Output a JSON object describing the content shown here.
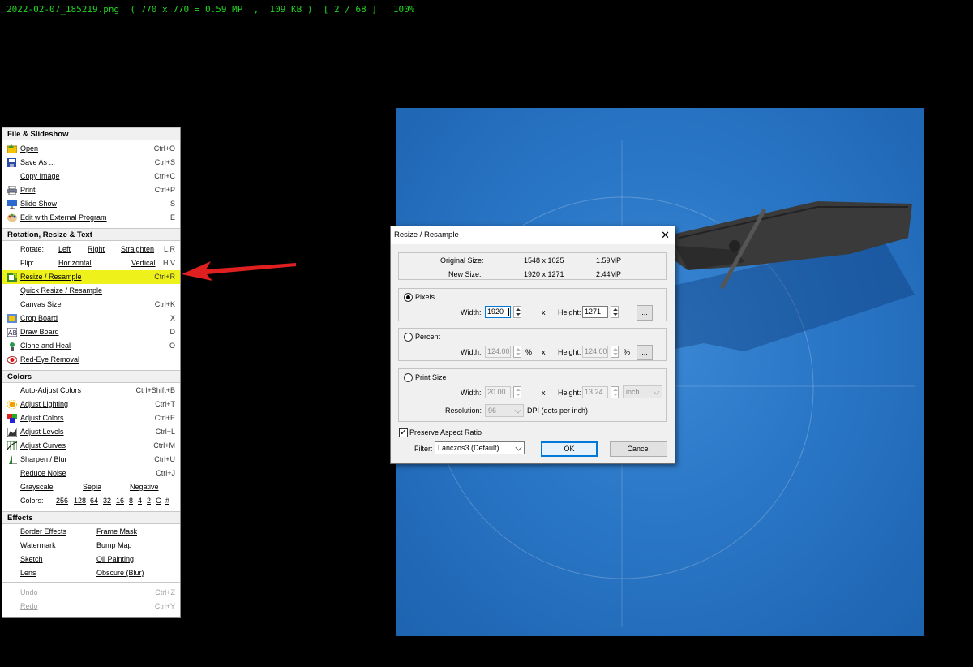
{
  "status_bar": "2022-02-07_185219.png  ( 770 x 770 = 0.59 MP  ,  109 KB )  [ 2 / 68 ]   100%",
  "colors": {
    "highlight": "#eef21a",
    "status_text": "#21d621",
    "accent": "#0078d7"
  },
  "menu": {
    "sections": {
      "file": "File & Slideshow",
      "rotation": "Rotation, Resize & Text",
      "colors": "Colors",
      "effects": "Effects"
    },
    "file_items": [
      {
        "label": "Open",
        "shortcut": "Ctrl+O",
        "icon": "folder-icon"
      },
      {
        "label": "Save As ...",
        "shortcut": "Ctrl+S",
        "icon": "floppy-icon"
      },
      {
        "label": "Copy Image",
        "shortcut": "Ctrl+C",
        "icon": ""
      },
      {
        "label": "Print",
        "shortcut": "Ctrl+P",
        "icon": "printer-icon"
      },
      {
        "label": "Slide Show",
        "shortcut": "S",
        "icon": "slideshow-icon"
      },
      {
        "label": "Edit with External Program",
        "shortcut": "E",
        "icon": "palette-icon"
      }
    ],
    "rotate": {
      "label": "Rotate:",
      "left": "Left",
      "right": "Right",
      "straighten": "Straighten",
      "shortcut": "L,R"
    },
    "flip": {
      "label": "Flip:",
      "horizontal": "Horizontal",
      "vertical": "Vertical",
      "shortcut": "H,V"
    },
    "rotation_items": [
      {
        "label": "Resize / Resample",
        "shortcut": "Ctrl+R",
        "icon": "resize-icon"
      },
      {
        "label": "Quick Resize / Resample",
        "shortcut": "",
        "icon": ""
      },
      {
        "label": "Canvas Size",
        "shortcut": "Ctrl+K",
        "icon": ""
      },
      {
        "label": "Crop Board",
        "shortcut": "X",
        "icon": "crop-icon"
      },
      {
        "label": "Draw Board",
        "shortcut": "D",
        "icon": "draw-icon"
      },
      {
        "label": "Clone and Heal",
        "shortcut": "O",
        "icon": "clone-icon"
      },
      {
        "label": "Red-Eye Removal",
        "shortcut": "",
        "icon": "eye-icon"
      }
    ],
    "color_items": [
      {
        "label": "Auto-Adjust Colors",
        "shortcut": "Ctrl+Shift+B",
        "icon": ""
      },
      {
        "label": "Adjust Lighting",
        "shortcut": "Ctrl+T",
        "icon": "sun-icon"
      },
      {
        "label": "Adjust Colors",
        "shortcut": "Ctrl+E",
        "icon": "color-squares-icon"
      },
      {
        "label": "Adjust Levels",
        "shortcut": "Ctrl+L",
        "icon": "levels-icon"
      },
      {
        "label": "Adjust Curves",
        "shortcut": "Ctrl+M",
        "icon": "curves-icon"
      },
      {
        "label": "Sharpen / Blur",
        "shortcut": "Ctrl+U",
        "icon": "sharpen-icon"
      },
      {
        "label": "Reduce Noise",
        "shortcut": "Ctrl+J",
        "icon": ""
      }
    ],
    "tone": {
      "grayscale": "Grayscale",
      "sepia": "Sepia",
      "negative": "Negative"
    },
    "colors_row": {
      "label": "Colors:",
      "values": [
        "256",
        "128",
        "64",
        "32",
        "16",
        "8",
        "4",
        "2",
        "G",
        "#"
      ]
    },
    "effects_rows": [
      [
        "Border Effects",
        "Frame Mask"
      ],
      [
        "Watermark",
        "Bump Map"
      ],
      [
        "Sketch",
        "Oil Painting"
      ],
      [
        "Lens",
        "Obscure (Blur)"
      ]
    ],
    "undo": {
      "label": "Undo",
      "shortcut": "Ctrl+Z"
    },
    "redo": {
      "label": "Redo",
      "shortcut": "Ctrl+Y"
    }
  },
  "dialog": {
    "title": "Resize / Resample",
    "original_label": "Original Size:",
    "original_dims": "1548 x 1025",
    "original_mp": "1.59MP",
    "new_label": "New Size:",
    "new_dims": "1920 x 1271",
    "new_mp": "2.44MP",
    "pixels": {
      "label": "Pixels",
      "width_label": "Width:",
      "width": "1920",
      "x": "x",
      "height_label": "Height:",
      "height": "1271",
      "dots": "..."
    },
    "percent": {
      "label": "Percent",
      "width_label": "Width:",
      "width": "124.00",
      "unit": "%",
      "x": "x",
      "height_label": "Height:",
      "height": "124.00",
      "dots": "..."
    },
    "print": {
      "label": "Print Size",
      "width_label": "Width:",
      "width": "20.00",
      "x": "x",
      "height_label": "Height:",
      "height": "13.24",
      "unit": "inch",
      "resolution_label": "Resolution:",
      "resolution": "96",
      "dpi": "DPI (dots per inch)"
    },
    "preserve": "Preserve Aspect Ratio",
    "filter_label": "Filter:",
    "filter": "Lanczos3 (Default)",
    "ok": "OK",
    "cancel": "Cancel"
  }
}
